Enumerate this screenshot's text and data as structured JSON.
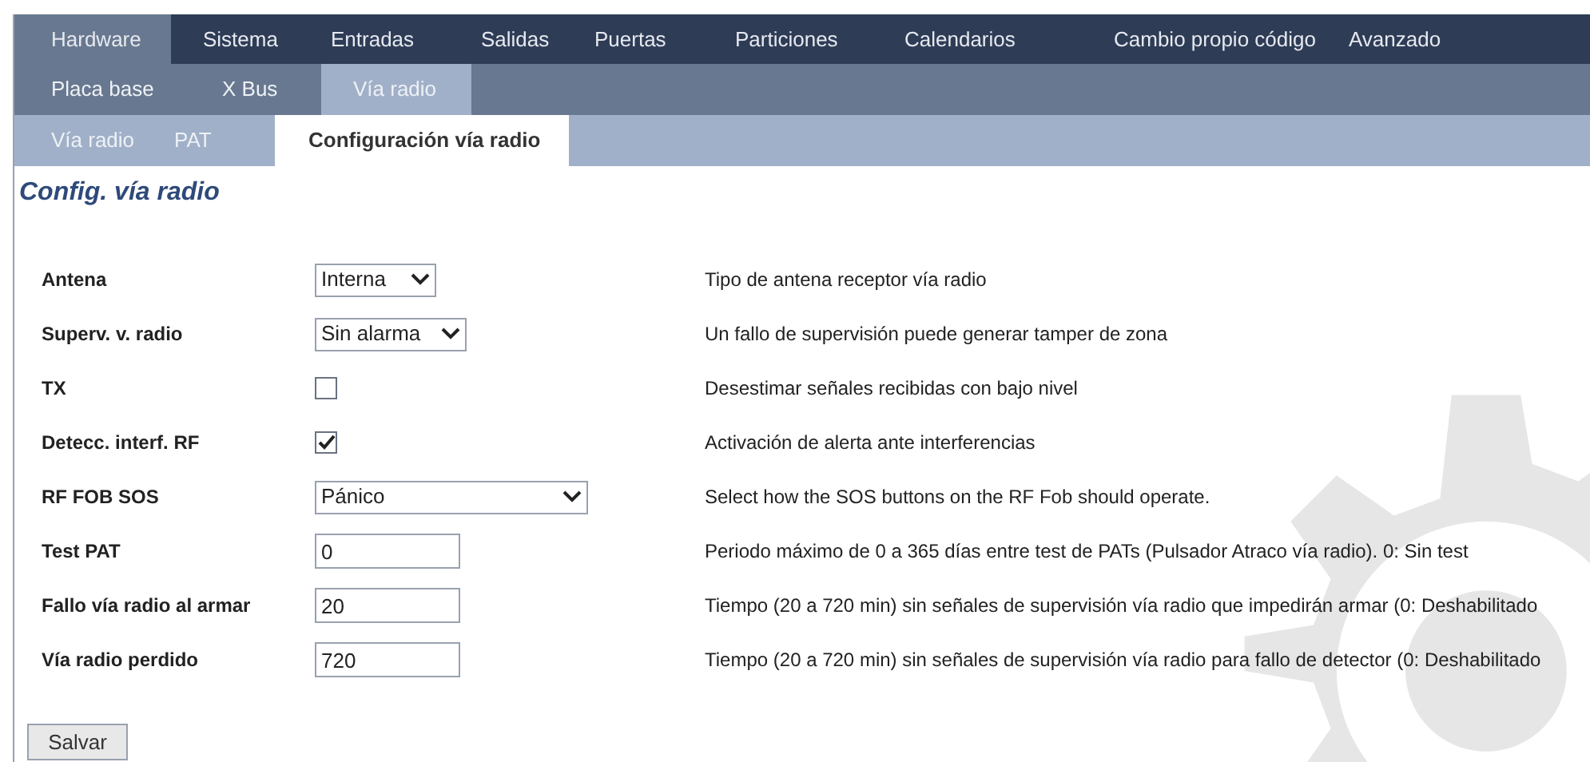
{
  "main_tabs": [
    {
      "label": "Hardware",
      "selected": true
    },
    {
      "label": "Sistema",
      "selected": false
    },
    {
      "label": "Entradas",
      "selected": false
    },
    {
      "label": "Salidas",
      "selected": false
    },
    {
      "label": "Puertas",
      "selected": false
    },
    {
      "label": "Particiones",
      "selected": false
    },
    {
      "label": "Calendarios",
      "selected": false
    },
    {
      "label": "Cambio propio código",
      "selected": false
    },
    {
      "label": "Avanzado",
      "selected": false
    }
  ],
  "sub_tabs": [
    {
      "label": "Placa base",
      "selected": false
    },
    {
      "label": "X Bus",
      "selected": false
    },
    {
      "label": "Vía radio",
      "selected": true
    }
  ],
  "section_tabs": [
    {
      "label": "Vía radio",
      "selected": false
    },
    {
      "label": "PAT",
      "selected": false
    },
    {
      "label": "Configuración vía radio",
      "selected": true
    }
  ],
  "page_title": "Config. vía radio",
  "settings": [
    {
      "label": "Antena",
      "kind": "select",
      "value": "Interna",
      "description": "Tipo de antena receptor vía radio"
    },
    {
      "label": "Superv. v. radio",
      "kind": "select",
      "value": "Sin alarma",
      "description": "Un fallo de supervisión puede generar tamper de zona"
    },
    {
      "label": "TX",
      "kind": "checkbox",
      "checked": false,
      "description": "Desestimar señales recibidas con bajo nivel"
    },
    {
      "label": "Detecc. interf. RF",
      "kind": "checkbox",
      "checked": true,
      "description": "Activación de alerta ante interferencias"
    },
    {
      "label": "RF FOB SOS",
      "kind": "select",
      "value": "Pánico",
      "description": "Select how the SOS buttons on the RF Fob should operate."
    },
    {
      "label": "Test PAT",
      "kind": "text",
      "value": "0",
      "description": "Periodo máximo de 0 a 365 días entre test de PATs (Pulsador Atraco vía radio). 0: Sin test"
    },
    {
      "label": "Fallo vía radio al armar",
      "kind": "text",
      "value": "20",
      "description": "Tiempo (20 a 720 min) sin señales de supervisión vía radio que impedirán armar (0: Deshabilitado"
    },
    {
      "label": "Vía radio perdido",
      "kind": "text",
      "value": "720",
      "description": "Tiempo (20 a 720 min) sin señales de supervisión vía radio para fallo de detector (0: Deshabilitado"
    }
  ],
  "save_button": "Salvar"
}
